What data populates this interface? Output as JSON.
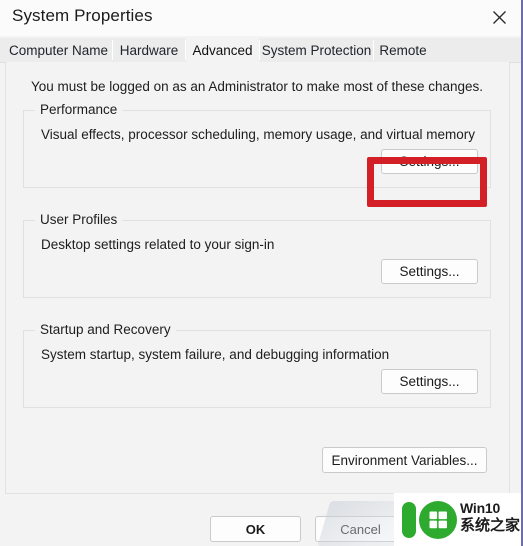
{
  "window": {
    "title": "System Properties",
    "close_icon": "close-icon"
  },
  "tabs": [
    {
      "label": "Computer Name",
      "active": false
    },
    {
      "label": "Hardware",
      "active": false
    },
    {
      "label": "Advanced",
      "active": true
    },
    {
      "label": "System Protection",
      "active": false
    },
    {
      "label": "Remote",
      "active": false
    }
  ],
  "main": {
    "admin_note": "You must be logged on as an Administrator to make most of these changes.",
    "groups": [
      {
        "legend": "Performance",
        "description": "Visual effects, processor scheduling, memory usage, and virtual memory",
        "button": "Settings...",
        "highlighted": true
      },
      {
        "legend": "User Profiles",
        "description": "Desktop settings related to your sign-in",
        "button": "Settings...",
        "highlighted": false
      },
      {
        "legend": "Startup and Recovery",
        "description": "System startup, system failure, and debugging information",
        "button": "Settings...",
        "highlighted": false
      }
    ],
    "environment_variables_button": "Environment Variables..."
  },
  "footer": {
    "ok": "OK",
    "cancel": "Cancel"
  },
  "watermark": {
    "brand": "Win10",
    "brand_cn": "系统之家",
    "logo_icon": "win10-logo-icon"
  },
  "colors": {
    "highlight": "#d32027",
    "watermark_green": "#2eab2e",
    "dialog_bg": "#f3f3f3",
    "titlebar_bg": "#fbfbfb"
  }
}
